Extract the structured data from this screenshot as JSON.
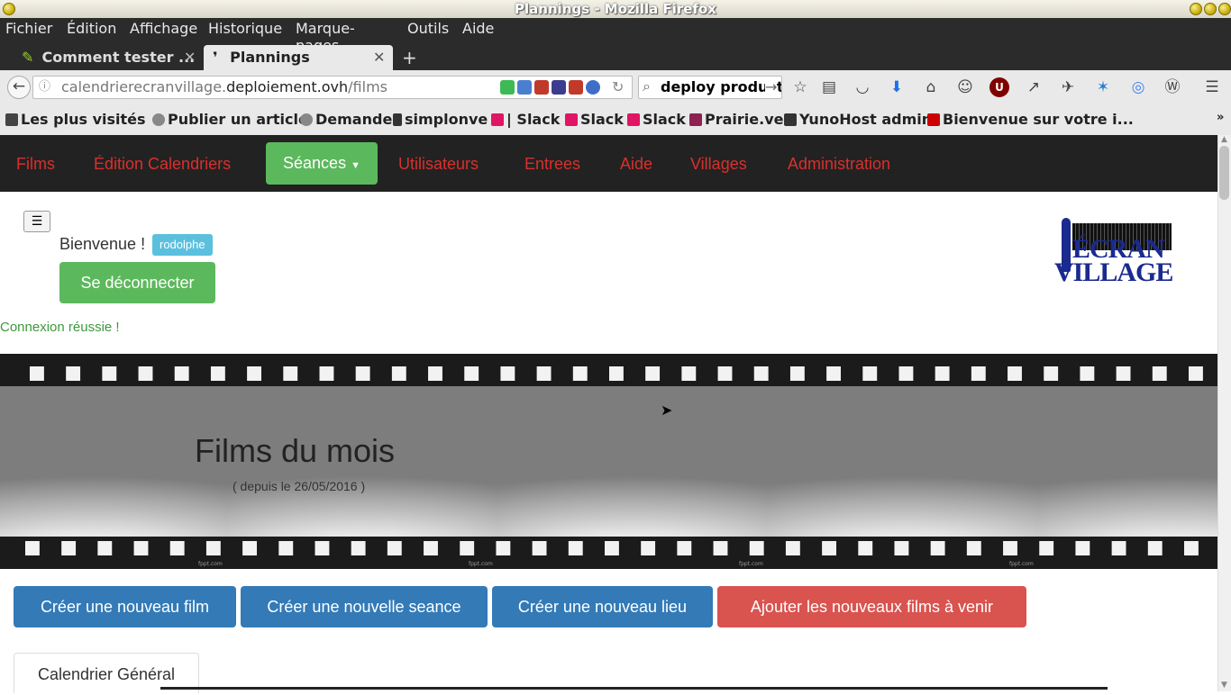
{
  "window": {
    "title": "Plannings - Mozilla Firefox"
  },
  "menu": [
    "Fichier",
    "Édition",
    "Affichage",
    "Historique",
    "Marque-pages",
    "Outils",
    "Aide"
  ],
  "tabs": [
    {
      "label": "Comment tester ..."
    },
    {
      "label": "Plannings"
    }
  ],
  "new_tab": "+",
  "url": {
    "host_prefix": "calendrierecranvillage.",
    "host_domain": "deploiement.ovh",
    "path": "/films"
  },
  "search": {
    "value": "deploy product"
  },
  "bookmarks": [
    {
      "label": "Les plus visités",
      "icon": "gear-icon",
      "color": "#444444"
    },
    {
      "label": "Publier un article",
      "icon": "globe-icon",
      "color": "#777777"
    },
    {
      "label": "Demande",
      "icon": "globe-icon",
      "color": "#777777"
    },
    {
      "label": "simplonve",
      "icon": "h-icon",
      "color": "#333333"
    },
    {
      "label": "| Slack",
      "icon": "slack-icon",
      "color": "#e01563"
    },
    {
      "label": "Slack",
      "icon": "slack-icon",
      "color": "#e01563"
    },
    {
      "label": "Slack",
      "icon": "slack-icon",
      "color": "#e01563"
    },
    {
      "label": "Prairie.ve",
      "icon": "hash-icon",
      "color": "#8b2252"
    },
    {
      "label": "YunoHost admin",
      "icon": "yunohost-icon",
      "color": "#333333"
    },
    {
      "label": "Bienvenue sur votre i...",
      "icon": "free-icon",
      "color": "#cc0000"
    }
  ],
  "site_nav": {
    "items": [
      "Films",
      "Édition Calendriers",
      "Séances",
      "Utilisateurs",
      "Entrees",
      "Aide",
      "Villages",
      "Administration"
    ],
    "active_index": 2,
    "active_color": "#5cb85c",
    "link_color": "#d9302c"
  },
  "user": {
    "welcome": "Bienvenue !",
    "name": "rodolphe",
    "logout": "Se déconnecter",
    "flash": "Connexion réussie !"
  },
  "logo": {
    "line1": "ÉCRAN",
    "line2": "VILLAGE"
  },
  "banner": {
    "title": "Films du mois",
    "subtitle": "( depuis le 26/05/2016 )",
    "watermark": "fppt.com"
  },
  "actions": [
    {
      "label": "Créer une nouveau film",
      "style": "primary"
    },
    {
      "label": "Créer une nouvelle seance",
      "style": "primary"
    },
    {
      "label": "Créer une nouveau lieu",
      "style": "primary"
    },
    {
      "label": "Ajouter les nouveaux films à venir",
      "style": "danger"
    }
  ],
  "calendar_tab": "Calendrier Général"
}
